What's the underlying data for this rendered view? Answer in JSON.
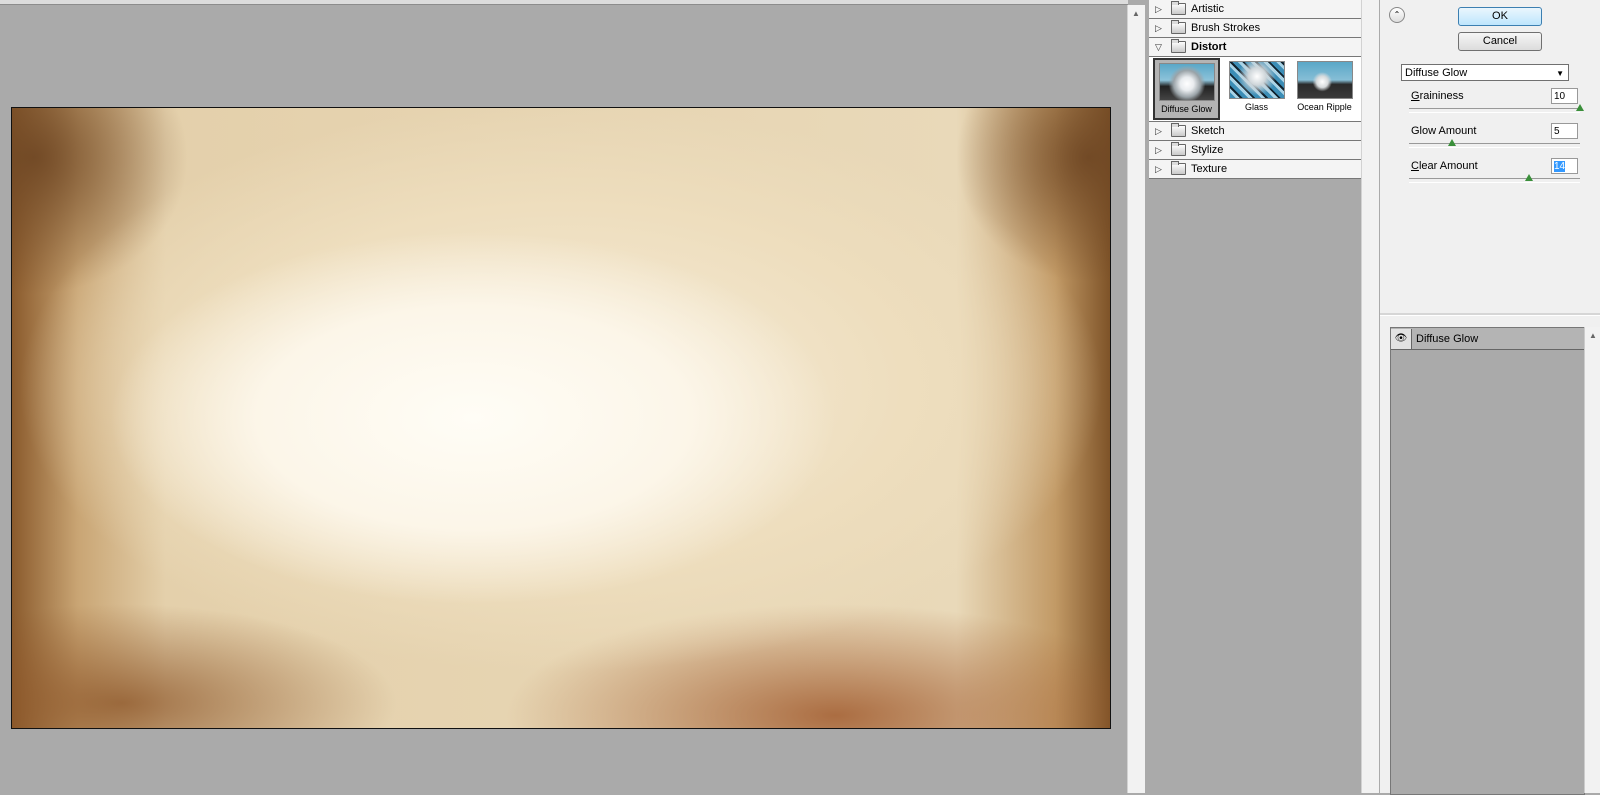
{
  "gallery": {
    "categories_top": [
      {
        "label": "Artistic",
        "expanded": false
      },
      {
        "label": "Brush Strokes",
        "expanded": false
      },
      {
        "label": "Distort",
        "expanded": true
      }
    ],
    "thumbnails": [
      {
        "label": "Diffuse Glow",
        "selected": true
      },
      {
        "label": "Glass",
        "selected": false
      },
      {
        "label": "Ocean Ripple",
        "selected": false
      }
    ],
    "categories_bottom": [
      {
        "label": "Sketch",
        "expanded": false
      },
      {
        "label": "Stylize",
        "expanded": false
      },
      {
        "label": "Texture",
        "expanded": false
      }
    ]
  },
  "settings": {
    "ok_label": "OK",
    "cancel_label": "Cancel",
    "filter_select": "Diffuse Glow",
    "params": [
      {
        "label_first": "G",
        "label_rest": "raininess",
        "value": "10",
        "level": 10,
        "max": 10
      },
      {
        "label_first": "",
        "label_rest": "Glow Amount",
        "value": "5",
        "level": 5,
        "max": 20
      },
      {
        "label_first": "C",
        "label_rest": "lear Amount",
        "value": "14",
        "level": 14,
        "max": 20
      }
    ]
  },
  "layers": [
    {
      "label": "Diffuse Glow"
    }
  ],
  "colors": {
    "background": "#aaaaaa",
    "ok_accent": "#3c7fb1",
    "selection": "#3399ff"
  }
}
